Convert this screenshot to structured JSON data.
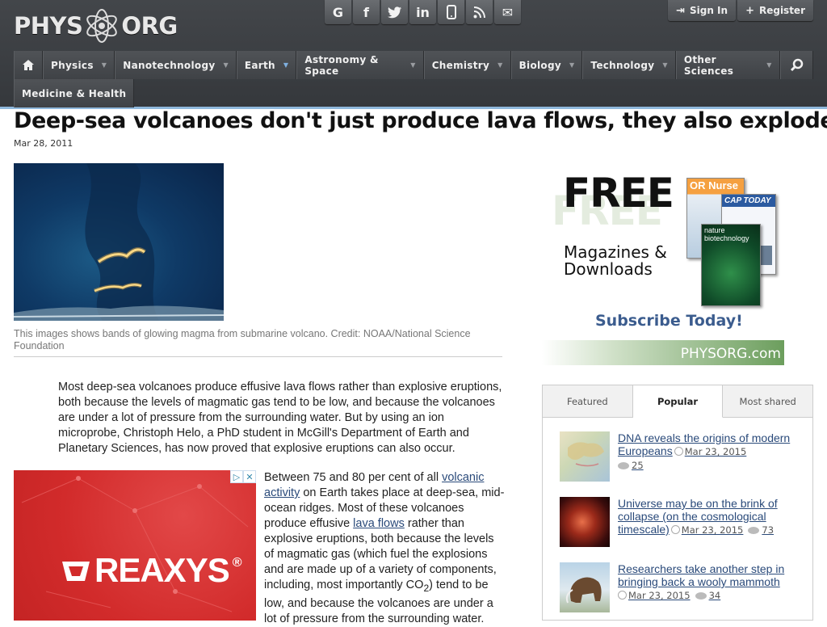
{
  "logo": {
    "left": "PHYS",
    "right": "ORG"
  },
  "social": [
    {
      "icon": "google-plus-icon",
      "glyph": "G"
    },
    {
      "icon": "facebook-icon",
      "glyph": "f"
    },
    {
      "icon": "twitter-icon",
      "glyph": "t"
    },
    {
      "icon": "linkedin-icon",
      "glyph": "in"
    },
    {
      "icon": "mobile-icon",
      "glyph": "▯"
    },
    {
      "icon": "rss-icon",
      "glyph": "≈"
    },
    {
      "icon": "email-icon",
      "glyph": "✉"
    }
  ],
  "auth": {
    "signin": "Sign In",
    "register": "Register"
  },
  "nav": {
    "items": [
      "Physics",
      "Nanotechnology",
      "Earth",
      "Astronomy & Space",
      "Chemistry",
      "Biology",
      "Technology",
      "Other Sciences"
    ],
    "second_row": "Medicine & Health"
  },
  "article": {
    "title": "Deep-sea volcanoes don't just produce lava flows, they also explode",
    "date": "Mar 28, 2011",
    "caption": "This images shows bands of glowing magma from submarine volcano. Credit: NOAA/National Science Foundation",
    "lead": "Most deep-sea volcanoes produce effusive lava flows rather than explosive eruptions, both because the levels of magmatic gas tend to be low, and because the volcanoes are under a lot of pressure from the surrounding water. But by using an ion microprobe, Christoph Helo, a PhD student in McGill's Department of Earth and Planetary Sciences, has now proved that explosive eruptions can also occur.",
    "p2_a": "Between 75 and 80 per cent of all ",
    "p2_link1": "volcanic activity",
    "p2_b": " on Earth takes place at deep-sea, mid-ocean ridges. Most of these volcanoes produce effusive ",
    "p2_link2": "lava flows",
    "p2_c": " rather than explosive eruptions, both because the levels of magmatic gas (which fuel the explosions and are made up of a variety of components, including, most importantly CO",
    "p2_sub": "2",
    "p2_d": ") tend to be low, and because the volcanoes are under a lot of pressure from the surrounding water."
  },
  "ad_left": {
    "brand": "REAXYS",
    "mark": "®"
  },
  "ad_right": {
    "free": "FREE",
    "line1": "Magazines &",
    "line2": "Downloads",
    "subscribe": "Subscribe Today!",
    "site": "PHYSORG.com",
    "cover1": "OR Nurse",
    "cover2": "CAP TODAY",
    "cover3": "nature biotechnology"
  },
  "tabs": {
    "items": [
      "Featured",
      "Popular",
      "Most shared"
    ],
    "active": "Popular"
  },
  "popular": [
    {
      "title": "DNA reveals the origins of modern Europeans",
      "date": "Mar 23, 2015",
      "comments": "25"
    },
    {
      "title": "Universe may be on the brink of collapse (on the cosmological timescale)",
      "date": "Mar 23, 2015",
      "comments": "73"
    },
    {
      "title": "Researchers take another step in bringing back a wooly mammoth",
      "date": "Mar 23, 2015",
      "comments": "34"
    }
  ]
}
